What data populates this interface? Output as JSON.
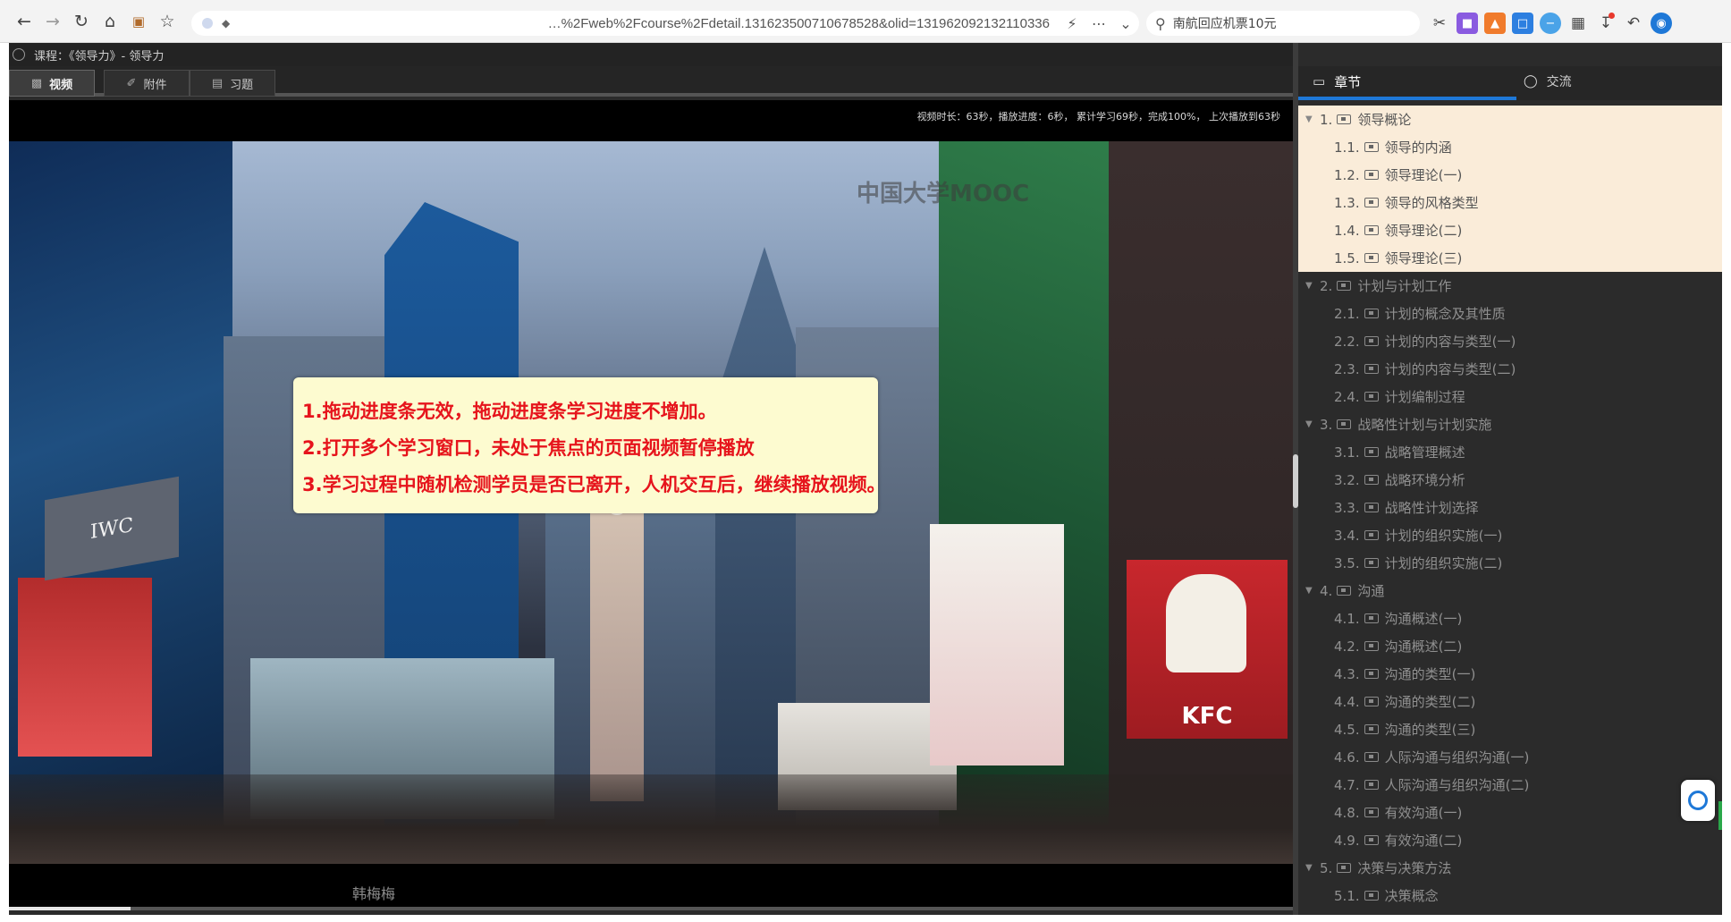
{
  "browser": {
    "url": "…%2Fweb%2Fcourse%2Fdetail.131623500710678528&olid=131962092132110336",
    "search_text": "南航回应机票10元"
  },
  "course": {
    "title": "课程：《领导力》- 领导力",
    "tabs": [
      {
        "label": "视频",
        "icon": "video-icon"
      },
      {
        "label": "附件",
        "icon": "paperclip-icon"
      },
      {
        "label": "习题",
        "icon": "quiz-icon"
      }
    ]
  },
  "video": {
    "stats": "视频时长：63秒，播放进度：6秒，  累计学习69秒，完成100%，  上次播放到63秒",
    "watermark": "中国大学MOOC",
    "notice": [
      "1.拖动进度条无效，拖动进度条学习进度不增加。",
      "2.打开多个学习窗口，未处于焦点的页面视频暂停播放",
      "3.学习过程中随机检测学员是否已离开，人机交互后，继续播放视频。"
    ],
    "user_name": "韩梅梅",
    "sign_iwc": "IWC",
    "sign_kfc": "KFC",
    "progress": 0.095
  },
  "sidebar": {
    "tabs": [
      {
        "label": "章节",
        "icon": "chapter-icon"
      },
      {
        "label": "交流",
        "icon": "chat-icon"
      }
    ],
    "toc": [
      {
        "num": "1.",
        "title": "领导概论",
        "type": "chapter",
        "highlight": true
      },
      {
        "num": "1.1.",
        "title": "领导的内涵",
        "type": "section",
        "highlight": true
      },
      {
        "num": "1.2.",
        "title": "领导理论(一)",
        "type": "section",
        "highlight": true
      },
      {
        "num": "1.3.",
        "title": "领导的风格类型",
        "type": "section",
        "highlight": true
      },
      {
        "num": "1.4.",
        "title": "领导理论(二)",
        "type": "section",
        "highlight": true
      },
      {
        "num": "1.5.",
        "title": "领导理论(三)",
        "type": "section",
        "highlight": true
      },
      {
        "num": "2.",
        "title": "计划与计划工作",
        "type": "chapter",
        "highlight": false
      },
      {
        "num": "2.1.",
        "title": "计划的概念及其性质",
        "type": "section",
        "highlight": false
      },
      {
        "num": "2.2.",
        "title": "计划的内容与类型(一)",
        "type": "section",
        "highlight": false
      },
      {
        "num": "2.3.",
        "title": "计划的内容与类型(二)",
        "type": "section",
        "highlight": false
      },
      {
        "num": "2.4.",
        "title": "计划编制过程",
        "type": "section",
        "highlight": false
      },
      {
        "num": "3.",
        "title": "战略性计划与计划实施",
        "type": "chapter",
        "highlight": false
      },
      {
        "num": "3.1.",
        "title": "战略管理概述",
        "type": "section",
        "highlight": false
      },
      {
        "num": "3.2.",
        "title": "战略环境分析",
        "type": "section",
        "highlight": false
      },
      {
        "num": "3.3.",
        "title": "战略性计划选择",
        "type": "section",
        "highlight": false
      },
      {
        "num": "3.4.",
        "title": "计划的组织实施(一)",
        "type": "section",
        "highlight": false
      },
      {
        "num": "3.5.",
        "title": "计划的组织实施(二)",
        "type": "section",
        "highlight": false
      },
      {
        "num": "4.",
        "title": "沟通",
        "type": "chapter",
        "highlight": false
      },
      {
        "num": "4.1.",
        "title": "沟通概述(一)",
        "type": "section",
        "highlight": false
      },
      {
        "num": "4.2.",
        "title": "沟通概述(二)",
        "type": "section",
        "highlight": false
      },
      {
        "num": "4.3.",
        "title": "沟通的类型(一)",
        "type": "section",
        "highlight": false
      },
      {
        "num": "4.4.",
        "title": "沟通的类型(二)",
        "type": "section",
        "highlight": false
      },
      {
        "num": "4.5.",
        "title": "沟通的类型(三)",
        "type": "section",
        "highlight": false
      },
      {
        "num": "4.6.",
        "title": "人际沟通与组织沟通(一)",
        "type": "section",
        "highlight": false
      },
      {
        "num": "4.7.",
        "title": "人际沟通与组织沟通(二)",
        "type": "section",
        "highlight": false
      },
      {
        "num": "4.8.",
        "title": "有效沟通(一)",
        "type": "section",
        "highlight": false
      },
      {
        "num": "4.9.",
        "title": "有效沟通(二)",
        "type": "section",
        "highlight": false
      },
      {
        "num": "5.",
        "title": "决策与决策方法",
        "type": "chapter",
        "highlight": false
      },
      {
        "num": "5.1.",
        "title": "决策概念",
        "type": "section",
        "highlight": false
      }
    ]
  }
}
